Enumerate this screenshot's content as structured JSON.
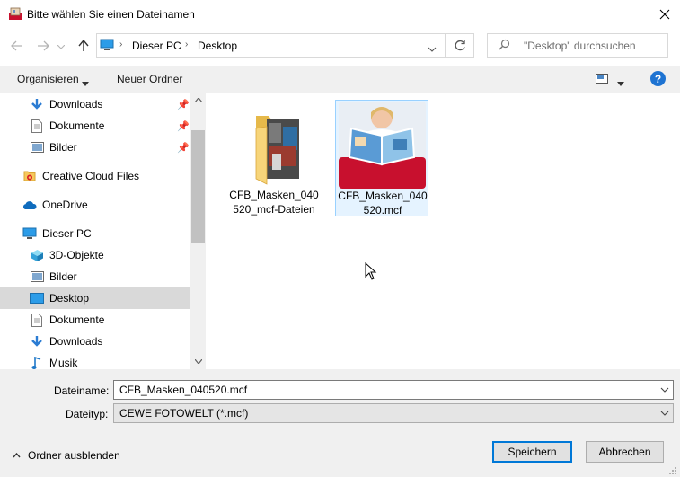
{
  "window": {
    "title": "Bitte wählen Sie einen Dateinamen"
  },
  "nav": {
    "breadcrumb": [
      "Dieser PC",
      "Desktop"
    ],
    "search_placeholder": "\"Desktop\" durchsuchen"
  },
  "toolbar": {
    "organize": "Organisieren",
    "new_folder": "Neuer Ordner"
  },
  "sidebar": {
    "items": [
      {
        "label": "Downloads",
        "icon": "download-arrow-icon",
        "pinned": true
      },
      {
        "label": "Dokumente",
        "icon": "document-icon",
        "pinned": true
      },
      {
        "label": "Bilder",
        "icon": "pictures-icon",
        "pinned": true
      },
      {
        "label": "Creative Cloud Files",
        "icon": "creative-cloud-icon"
      },
      {
        "label": "OneDrive",
        "icon": "onedrive-cloud-icon"
      },
      {
        "label": "Dieser PC",
        "icon": "computer-icon"
      },
      {
        "label": "3D-Objekte",
        "icon": "3d-objects-icon"
      },
      {
        "label": "Bilder",
        "icon": "pictures-icon"
      },
      {
        "label": "Desktop",
        "icon": "desktop-icon",
        "selected": true
      },
      {
        "label": "Dokumente",
        "icon": "document-icon"
      },
      {
        "label": "Downloads",
        "icon": "download-arrow-icon"
      },
      {
        "label": "Musik",
        "icon": "music-note-icon"
      }
    ]
  },
  "files": [
    {
      "label": "CFB_Masken_040520_mcf-Dateien",
      "type": "folder"
    },
    {
      "label": "CFB_Masken_040520.mcf",
      "type": "mcf",
      "selected": true
    }
  ],
  "form": {
    "filename_label": "Dateiname:",
    "filename_value": "CFB_Masken_040520.mcf",
    "filetype_label": "Dateityp:",
    "filetype_value": "CEWE FOTOWELT (*.mcf)"
  },
  "buttons": {
    "save": "Speichern",
    "cancel": "Abbrechen",
    "hide_folders": "Ordner ausblenden"
  }
}
